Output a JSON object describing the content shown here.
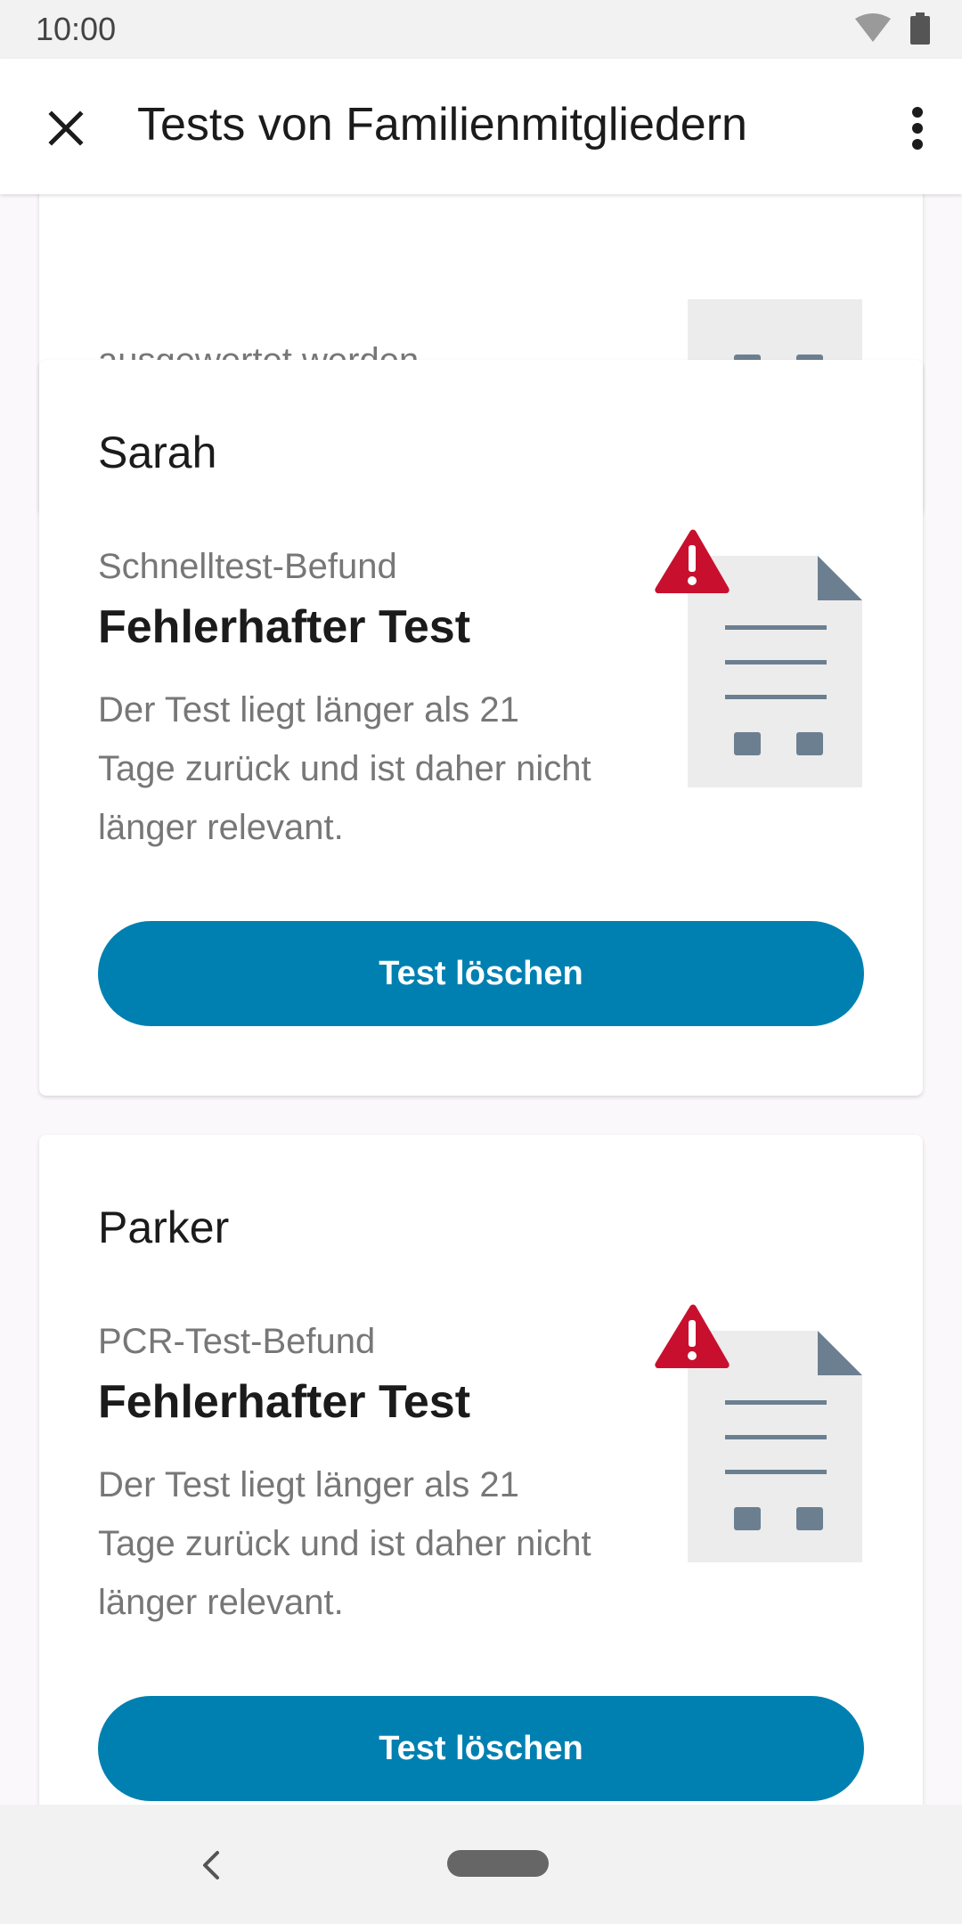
{
  "status_bar": {
    "time": "10:00"
  },
  "app_bar": {
    "title": "Tests von Familienmitgliedern"
  },
  "partial_card": {
    "text": "ausgewertet werden."
  },
  "cards": [
    {
      "name": "Sarah",
      "test_type": "Schnelltest-Befund",
      "result": "Fehlerhafter Test",
      "description": "Der Test liegt länger als 21 Tage zurück und ist daher nicht länger relevant.",
      "button_label": "Test löschen"
    },
    {
      "name": "Parker",
      "test_type": "PCR-Test-Befund",
      "result": "Fehlerhafter Test",
      "description": "Der Test liegt länger als 21 Tage zurück und ist daher nicht länger relevant.",
      "button_label": "Test löschen"
    }
  ],
  "colors": {
    "accent": "#0080b1",
    "warning": "#c8102e",
    "doc_gray": "#ececec",
    "doc_slate": "#6b7f90"
  },
  "icons": {
    "close": "close-icon",
    "overflow": "more-vert-icon",
    "warning": "warning-icon",
    "document": "document-icon",
    "back": "back-icon"
  }
}
